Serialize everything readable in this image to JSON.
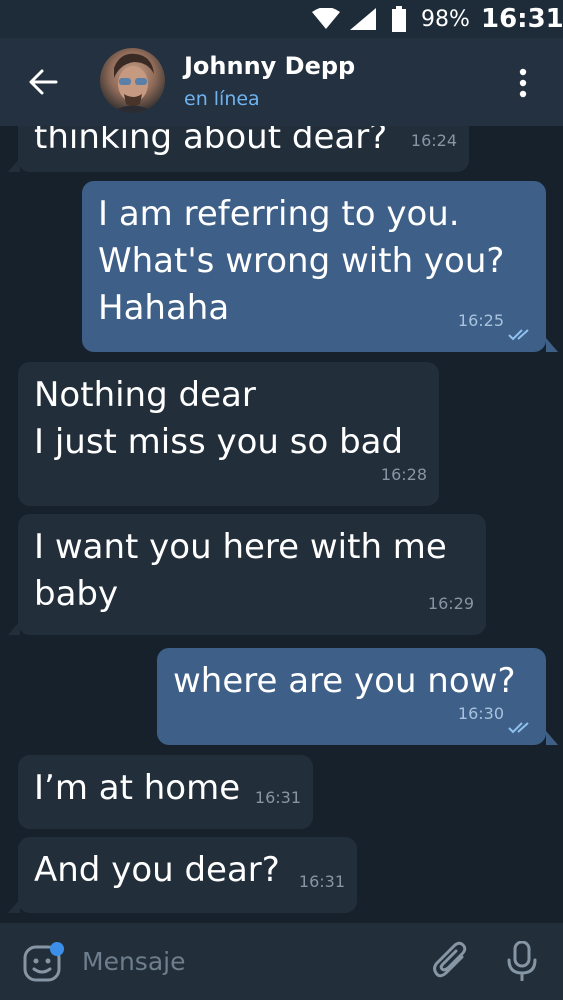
{
  "status_bar": {
    "battery": "98%",
    "time": "16:31"
  },
  "header": {
    "name": "Johnny Depp",
    "status": "en línea"
  },
  "messages": [
    {
      "dir": "in",
      "text": "thinking about dear?",
      "time": "16:24"
    },
    {
      "dir": "out",
      "lines": [
        "I am referring to you.",
        "What's wrong with you?",
        "Hahaha"
      ],
      "time": "16:25",
      "read": true
    },
    {
      "dir": "in",
      "lines": [
        "Nothing dear",
        "I just miss you so bad"
      ],
      "time": "16:28"
    },
    {
      "dir": "in",
      "lines": [
        "I want you here with me",
        "baby"
      ],
      "time": "16:29"
    },
    {
      "dir": "out",
      "text": "where are you now?",
      "time": "16:30",
      "read": true
    },
    {
      "dir": "in",
      "text": "I’m at home",
      "time": "16:31"
    },
    {
      "dir": "in",
      "text": "And you dear?",
      "time": "16:31"
    }
  ],
  "composer": {
    "placeholder": "Mensaje"
  },
  "colors": {
    "background": "#17212b",
    "header": "#243140",
    "incoming": "#222e3a",
    "outgoing": "#3e5f87",
    "accent": "#6fb3ef"
  },
  "icons": [
    "wifi-icon",
    "signal-icon",
    "battery-icon",
    "back-arrow-icon",
    "more-vert-icon",
    "sticker-icon",
    "attach-icon",
    "mic-icon",
    "double-check-icon"
  ]
}
